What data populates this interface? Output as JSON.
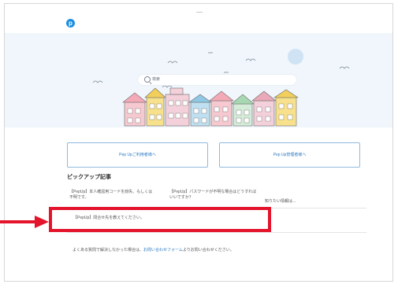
{
  "header": {
    "logo_text": "p"
  },
  "search": {
    "placeholder": "検索"
  },
  "nav": {
    "user_button": "Pep Upご利用者様へ",
    "admin_button": "Pep Up管理者様へ"
  },
  "pickup": {
    "title": "ピックアップ記事",
    "articles": [
      {
        "text": "【PepUp】本人確認用コードを紛失、もしくは不明です。"
      },
      {
        "text": "【PepUp】パスワードが不明な場合はどうすればいいですか？"
      },
      {
        "text": "知りたい情報は..."
      },
      {
        "text": "【PepUp】問合せ先を教えてください。"
      }
    ]
  },
  "footer": {
    "before": "よくある質問で解決しなかった場合は、",
    "link": "お問い合わせフォーム",
    "after": "よりお問い合わせください。"
  },
  "colors": {
    "brand_blue": "#1c8fe0",
    "highlight_red": "#e3142b",
    "hero_bg": "#f0f6fb"
  },
  "icons": [
    "logo-icon",
    "search-icon",
    "highlight-arrow-icon"
  ]
}
